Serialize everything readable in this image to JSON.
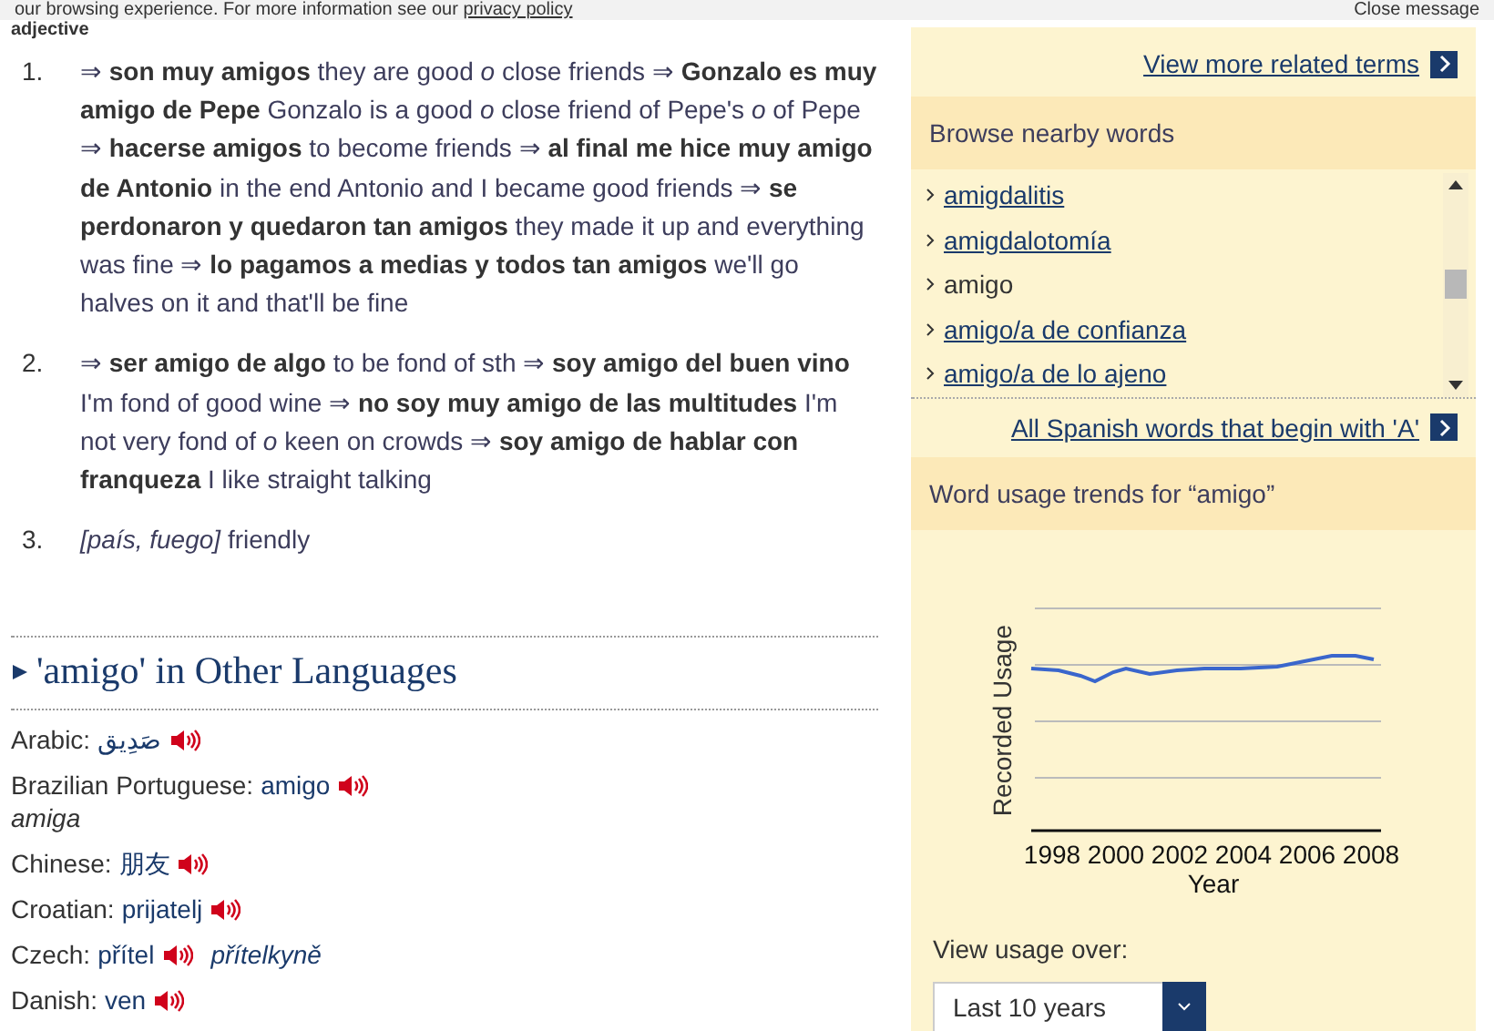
{
  "cookie_notice": {
    "text": "our browsing experience. For more information see our",
    "link": "privacy policy",
    "close": "Close message"
  },
  "part_of_speech": "adjective",
  "senses": [
    {
      "number": "1.",
      "text": "⇒ **son muy amigos** they are good *o* close friends   ⇒ **Gonzalo es muy amigo de Pepe** Gonzalo is a good *o* close friend of Pepe's *o* of Pepe   ⇒ **hacerse amigos** to become friends   ⇒ **al final me hice muy amigo de Antonio** in the end Antonio and I became good friends   ⇒ **se perdonaron y quedaron tan amigos** they made it up and everything was fine   ⇒ **lo pagamos a medias y todos tan amigos** we'll go halves on it and that'll be fine"
    },
    {
      "number": "2.",
      "text": "⇒ **ser amigo de algo** to be fond of sth   ⇒ **soy amigo del buen vino** I'm fond of good wine   ⇒ **no soy muy amigo de las multitudes** I'm not very fond of *o* keen on crowds   ⇒ **soy amigo de hablar con franqueza** I like straight talking"
    },
    {
      "number": "3.",
      "text": "*[país, fuego]* friendly"
    }
  ],
  "other_languages": {
    "title": "'amigo' in Other Languages",
    "items": [
      {
        "kind": "plain",
        "language": "Arabic:",
        "word": "صَدِيق"
      },
      {
        "kind": "below",
        "language": "Brazilian Portuguese:",
        "word": "amigo",
        "alt": "amiga"
      },
      {
        "kind": "plain",
        "language": "Chinese:",
        "word": "朋友"
      },
      {
        "kind": "plain",
        "language": "Croatian:",
        "word": "prijatelj"
      },
      {
        "kind": "inline",
        "language": "Czech:",
        "word": "přítel",
        "alt": "přítelkyně"
      },
      {
        "kind": "plain",
        "language": "Danish:",
        "word": "ven"
      }
    ]
  },
  "sidebar": {
    "related_link": "View more related terms",
    "nearby": {
      "title": "Browse nearby words",
      "items": [
        {
          "label": "amigdalitis",
          "current": false
        },
        {
          "label": "amigdalotomía",
          "current": false
        },
        {
          "label": "amigo",
          "current": true
        },
        {
          "label": "amigo/a de confianza",
          "current": false
        },
        {
          "label": "amigo/a de lo ajeno",
          "current": false
        }
      ],
      "all_link": "All Spanish words that begin with 'A'"
    },
    "trends": {
      "title": "Word usage trends for “amigo”",
      "ylabel": "Recorded Usage",
      "xlabel": "Year",
      "x_tick_labels": [
        "1998",
        "2000",
        "2002",
        "2004",
        "2006",
        "2008"
      ],
      "period_label": "View usage over:",
      "period_value": "Last 10 years"
    }
  }
}
